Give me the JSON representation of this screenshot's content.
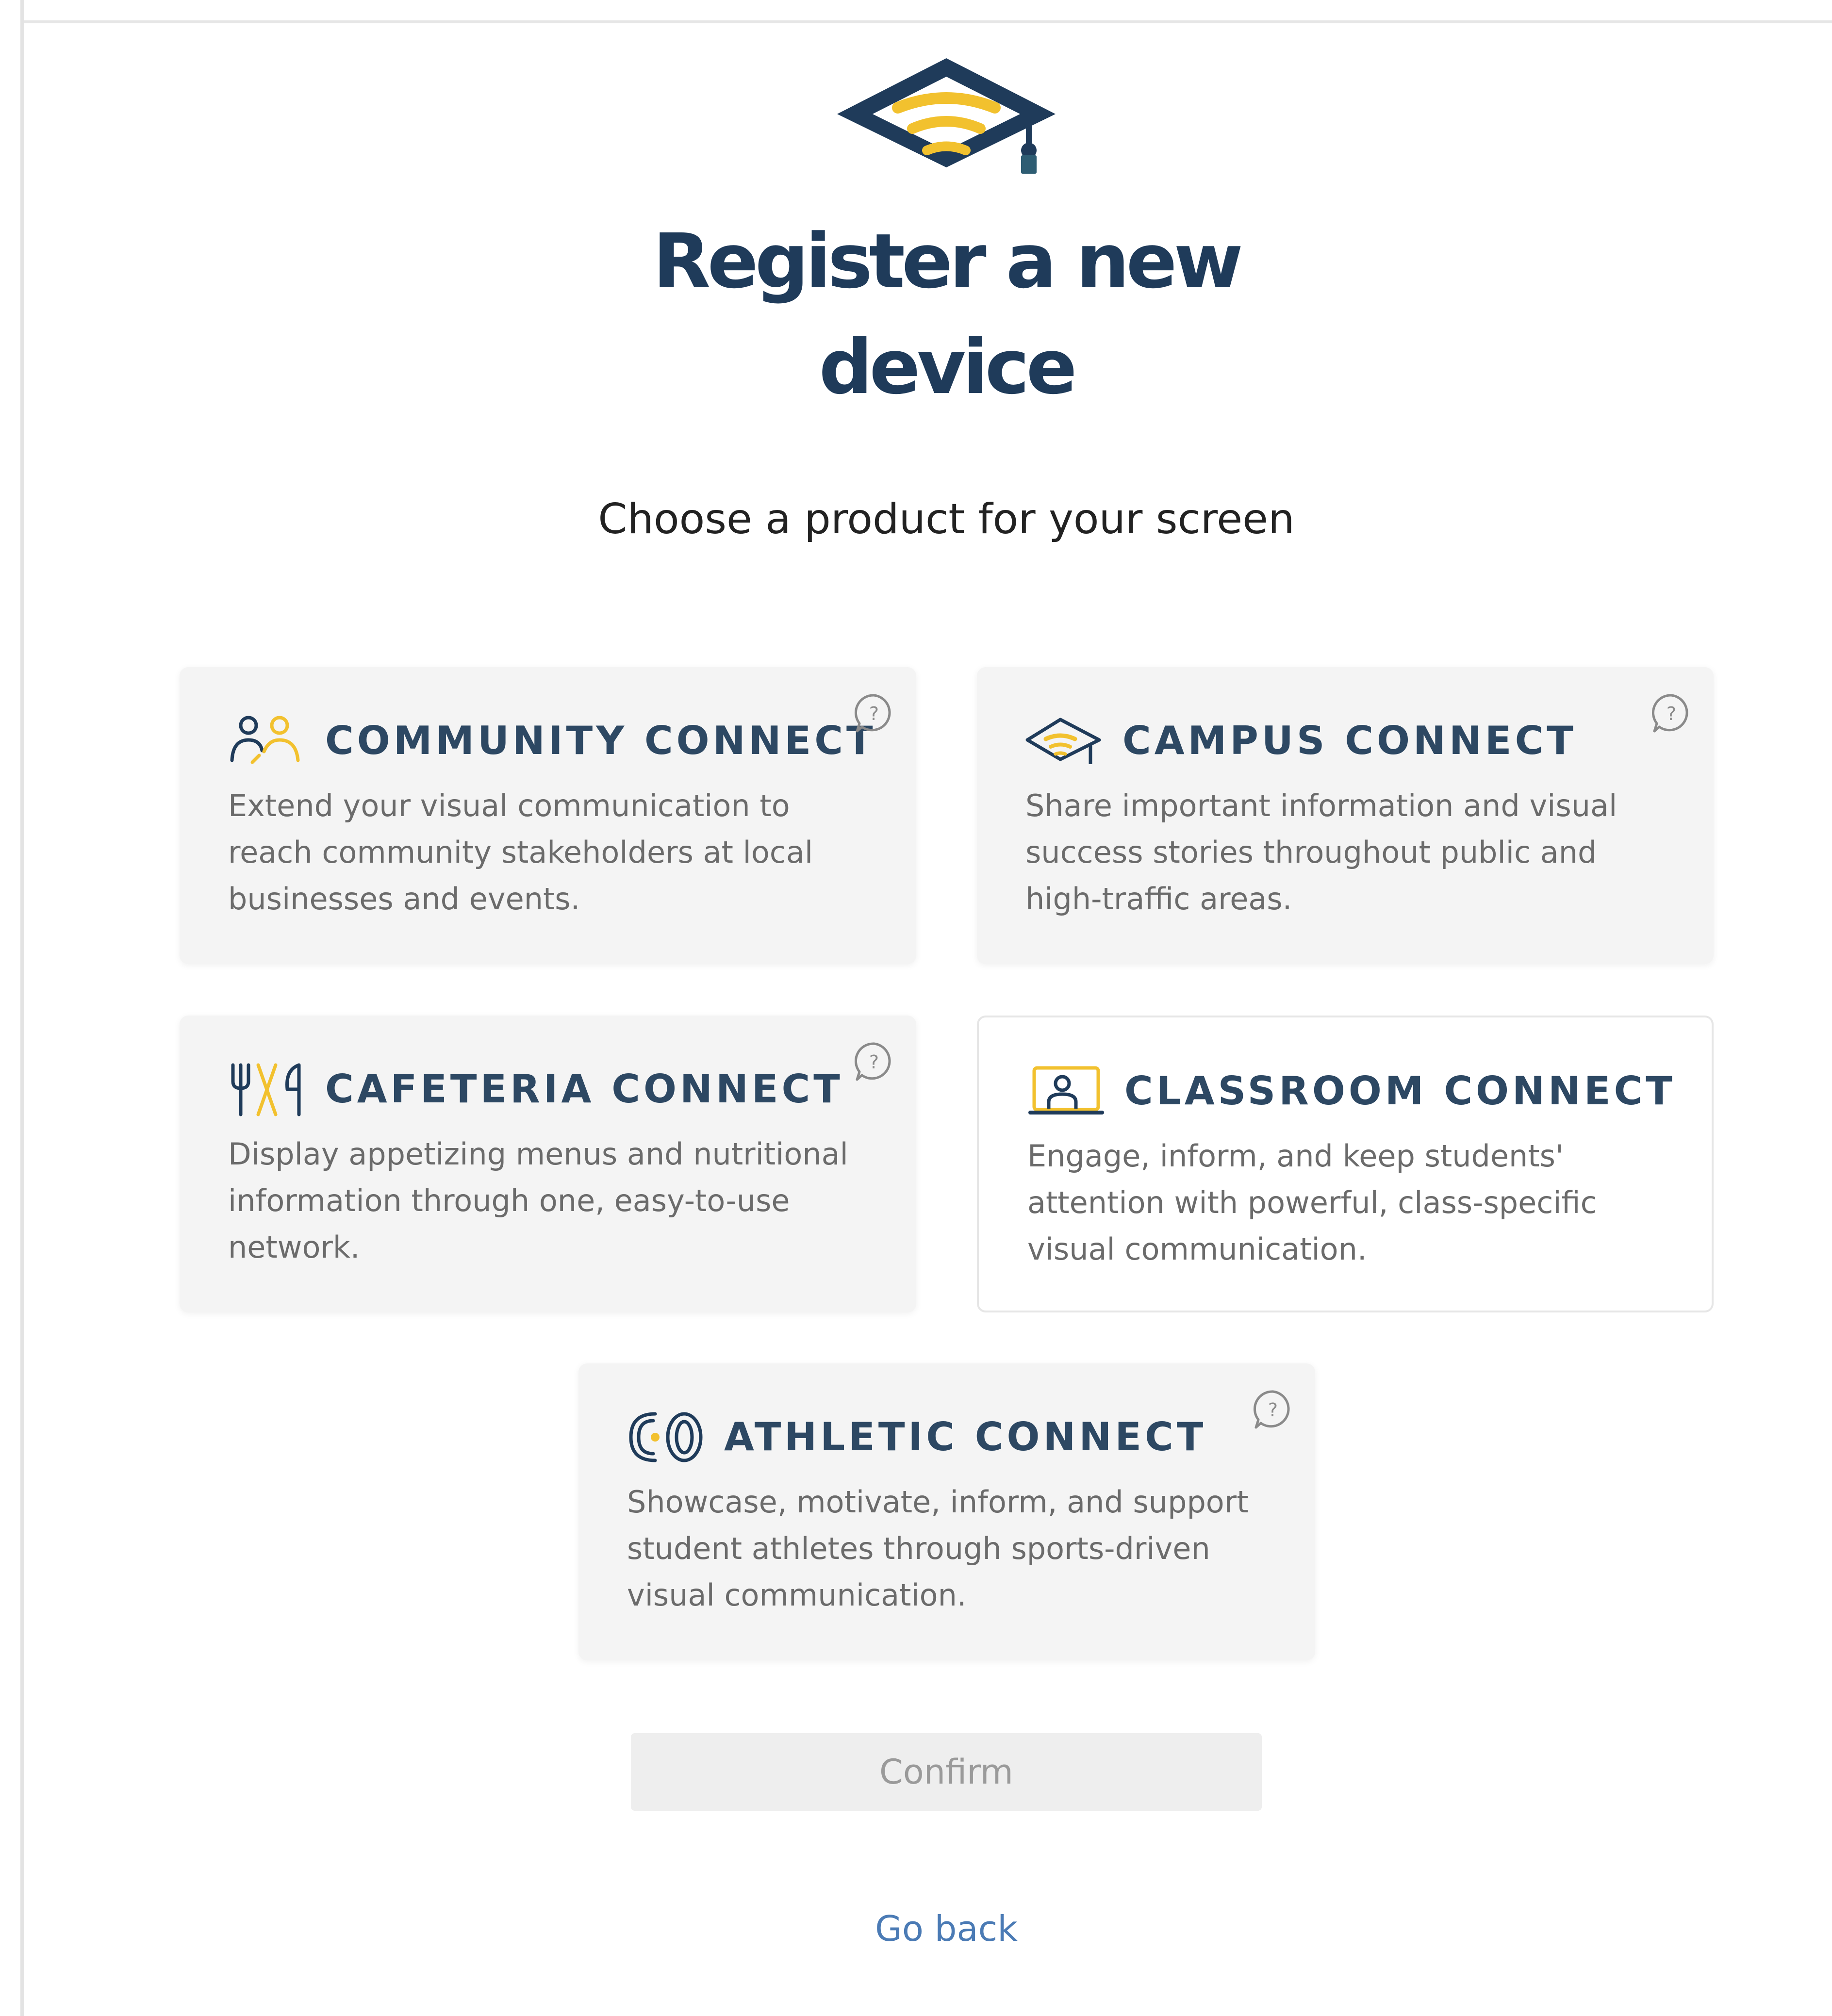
{
  "page": {
    "title": "Register a new device",
    "subtitle": "Choose a product for your screen"
  },
  "colors": {
    "brand_navy": "#1f3b5a",
    "brand_yellow": "#f2c12e",
    "card_background": "#f4f4f4",
    "link": "#4b7bb5"
  },
  "logo": {
    "icon": "graduation-cap-signal-icon"
  },
  "products": [
    {
      "title": "COMMUNITY CONNECT",
      "description": "Extend your visual communication to reach community stakeholders at local businesses and events.",
      "icon": "people-icon",
      "has_help": true
    },
    {
      "title": "CAMPUS CONNECT",
      "description": "Share important information and visual success stories throughout public and high-traffic areas.",
      "icon": "graduation-cap-icon",
      "has_help": true
    },
    {
      "title": "CAFETERIA CONNECT",
      "description": "Display appetizing menus and nutritional information through one, easy-to-use network.",
      "icon": "utensils-icon",
      "has_help": true
    },
    {
      "title": "CLASSROOM CONNECT",
      "description": "Engage, inform, and keep students' attention with powerful, class-specific visual communication.",
      "icon": "presenter-screen-icon",
      "has_help": false
    },
    {
      "title": "ATHLETIC CONNECT",
      "description": "Showcase, motivate, inform, and support student athletes through sports-driven visual communication.",
      "icon": "stadium-track-icon",
      "has_help": true
    }
  ],
  "actions": {
    "confirm_label": "Confirm",
    "go_back_label": "Go back"
  }
}
